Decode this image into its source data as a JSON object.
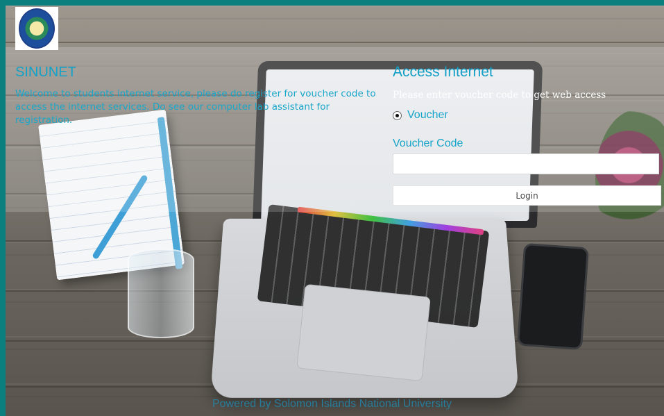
{
  "brand": {
    "name": "SINUNET",
    "logo_icon": "university-crest-icon"
  },
  "welcome_text": "Welcome to students internet service, please do register for voucher code to access the internet services. Do see our computer lab assistant for registration.",
  "access": {
    "title": "Access Internet",
    "subtitle": "Please enter voucher code to get web access",
    "auth_method": {
      "label": "Voucher",
      "selected": true
    },
    "voucher_code": {
      "label": "Voucher Code",
      "value": "",
      "placeholder": ""
    },
    "login_label": "Login"
  },
  "footer": "Powered by Solomon Islands National University",
  "colors": {
    "frame": "#0b7f7d",
    "text_accent": "#17a4c9"
  }
}
